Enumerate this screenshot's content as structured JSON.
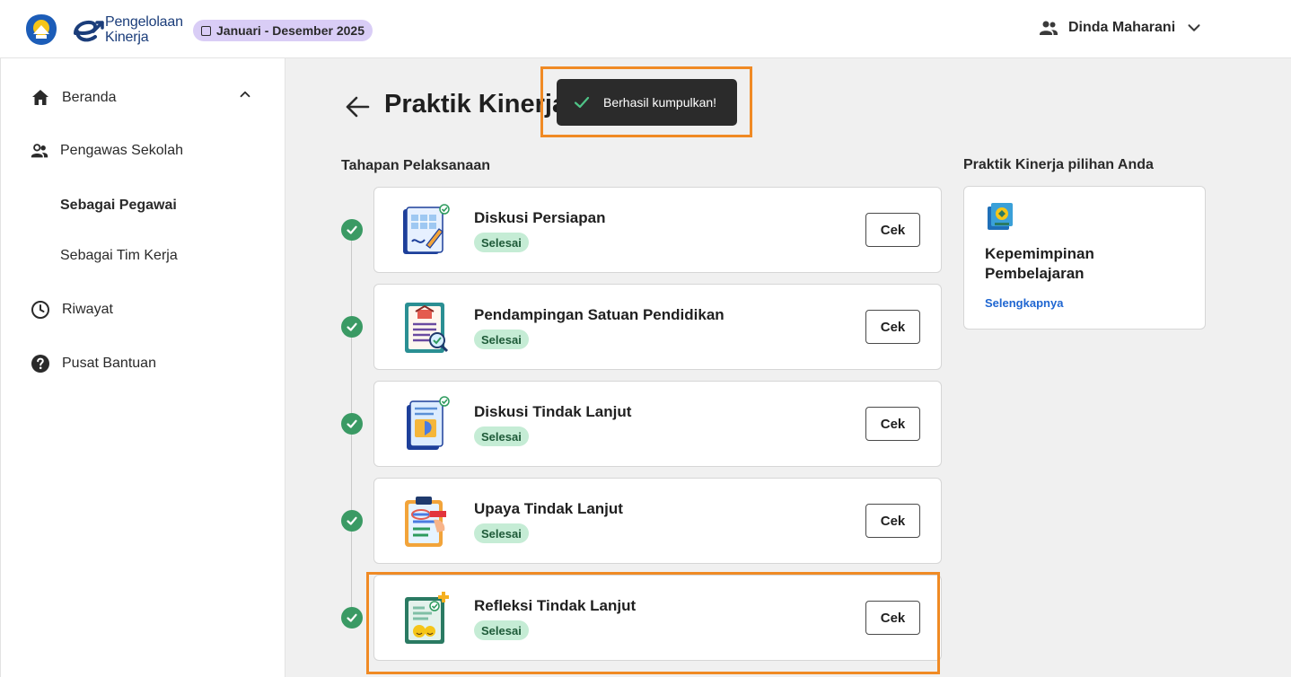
{
  "header": {
    "brand_line1": "Pengelolaan",
    "brand_line2": "Kinerja",
    "period": "Januari - Desember 2025",
    "user_name": "Dinda Maharani"
  },
  "sidebar": {
    "items": [
      {
        "label": "Beranda",
        "icon": "home-icon"
      },
      {
        "label": "Pengawas Sekolah",
        "icon": "people-icon"
      },
      {
        "label": "Sebagai Pegawai",
        "active": true
      },
      {
        "label": "Sebagai Tim Kerja"
      },
      {
        "label": "Riwayat",
        "icon": "clock-icon"
      },
      {
        "label": "Pusat Bantuan",
        "icon": "help-icon"
      }
    ]
  },
  "main": {
    "title": "Praktik Kinerja",
    "toast": "Berhasil kumpulkan!",
    "stages_label": "Tahapan Pelaksanaan",
    "stages": [
      {
        "title": "Diskusi Persiapan",
        "status": "Selesai",
        "action": "Cek"
      },
      {
        "title": "Pendampingan Satuan Pendidikan",
        "status": "Selesai",
        "action": "Cek"
      },
      {
        "title": "Diskusi Tindak Lanjut",
        "status": "Selesai",
        "action": "Cek"
      },
      {
        "title": "Upaya Tindak Lanjut",
        "status": "Selesai",
        "action": "Cek"
      },
      {
        "title": "Refleksi Tindak Lanjut",
        "status": "Selesai",
        "action": "Cek"
      }
    ],
    "choice_label": "Praktik Kinerja pilihan Anda",
    "choice": {
      "name": "Kepemimpinan Pembelajaran",
      "link": "Selengkapnya"
    }
  },
  "colors": {
    "success": "#3a9a64",
    "badge_bg": "#c5ecd5",
    "chip_bg": "#d9cdf6",
    "highlight": "#f08a24",
    "link": "#1f66d1"
  }
}
